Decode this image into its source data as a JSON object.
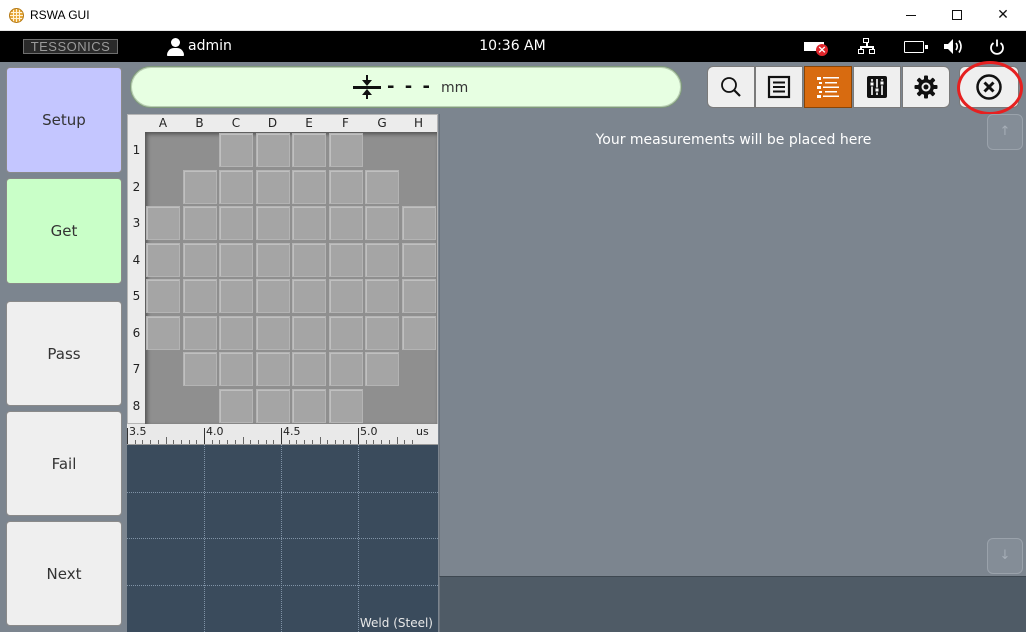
{
  "window": {
    "title": "RSWA GUI"
  },
  "status": {
    "logo": "TESSONICS",
    "username": "admin",
    "time": "10:36 AM",
    "icons": [
      "no-media-icon",
      "network-icon",
      "battery-icon",
      "volume-icon",
      "power-icon"
    ]
  },
  "sidebar": {
    "setup": "Setup",
    "get": "Get",
    "pass": "Pass",
    "fail": "Fail",
    "next": "Next"
  },
  "measurement": {
    "value": "- - -",
    "unit": "mm"
  },
  "toolbar": {
    "icons": [
      "search-icon",
      "list-icon",
      "detailed-list-icon",
      "adjust-icon",
      "gear-icon",
      "close-circle-icon"
    ],
    "active": "detailed-list-icon"
  },
  "grid": {
    "columns": [
      "A",
      "B",
      "C",
      "D",
      "E",
      "F",
      "G",
      "H"
    ],
    "rows": [
      "1",
      "2",
      "3",
      "4",
      "5",
      "6",
      "7",
      "8"
    ],
    "active_cells": [
      [
        2,
        3,
        4,
        5
      ],
      [
        1,
        2,
        3,
        4,
        5,
        6
      ],
      [
        0,
        1,
        2,
        3,
        4,
        5,
        6,
        7
      ],
      [
        0,
        1,
        2,
        3,
        4,
        5,
        6,
        7
      ],
      [
        0,
        1,
        2,
        3,
        4,
        5,
        6,
        7
      ],
      [
        0,
        1,
        2,
        3,
        4,
        5,
        6,
        7
      ],
      [
        1,
        2,
        3,
        4,
        5,
        6
      ],
      [
        2,
        3,
        4,
        5
      ]
    ]
  },
  "ascan": {
    "ticks": [
      "3.5",
      "4.0",
      "4.5",
      "5.0"
    ],
    "unit": "us",
    "material": "Weld (Steel)"
  },
  "measurements_panel": {
    "placeholder": "Your measurements will be placed here",
    "scroll_up": "↑",
    "scroll_down": "↓"
  },
  "colors": {
    "setup": "#c4c6ff",
    "get": "#c9ffc8",
    "active_tool": "#d86b10",
    "highlight": "#e62020",
    "panel": "#7c858f"
  }
}
